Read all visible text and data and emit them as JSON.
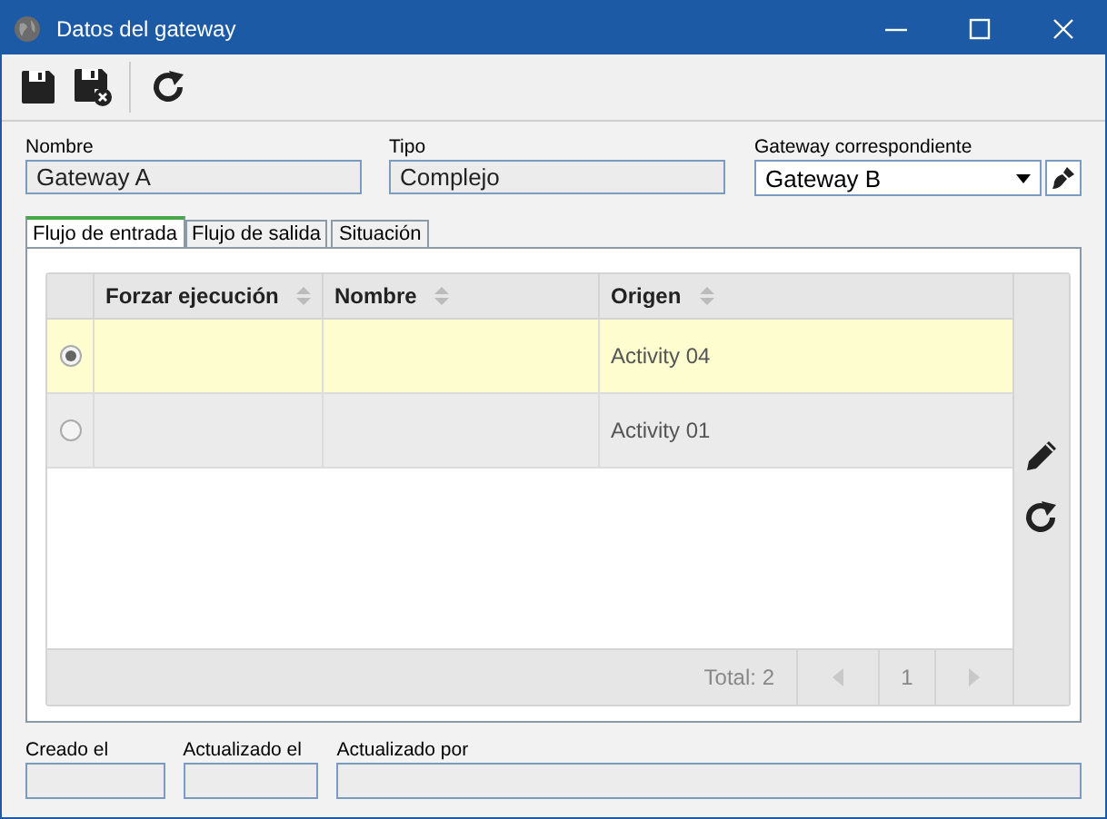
{
  "window": {
    "title": "Datos del gateway"
  },
  "fields": [
    {
      "label": "Nombre",
      "value": "Gateway A",
      "kind": "text"
    },
    {
      "label": "Tipo",
      "value": "Complejo",
      "kind": "text"
    },
    {
      "label": "Gateway correspondiente",
      "value": "Gateway B",
      "kind": "dropdown"
    }
  ],
  "tabs": [
    {
      "label": "Flujo de entrada",
      "selected": true
    },
    {
      "label": "Flujo de salida",
      "selected": false
    },
    {
      "label": "Situación",
      "selected": false
    }
  ],
  "table": {
    "columns": [
      "Forzar ejecución",
      "Nombre",
      "Origen"
    ],
    "rows": [
      {
        "selected": true,
        "origin": "Activity 04"
      },
      {
        "selected": false,
        "origin": "Activity 01"
      }
    ],
    "total": "Total: 2",
    "page": "1"
  },
  "audit": [
    {
      "label": "Creado el"
    },
    {
      "label": "Actualizado el"
    },
    {
      "label": "Actualizado por"
    }
  ]
}
